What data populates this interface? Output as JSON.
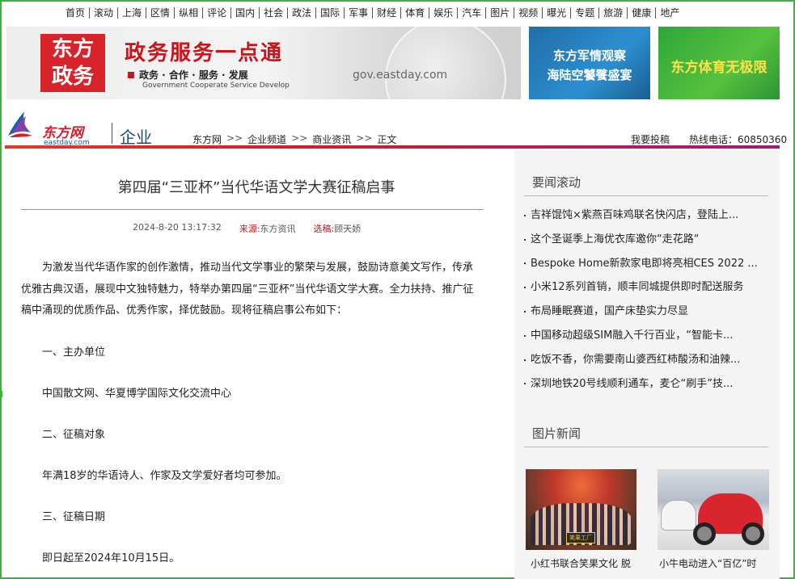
{
  "topnav": [
    "首页",
    "滚动",
    "上海",
    "区情",
    "纵相",
    "评论",
    "国内",
    "社会",
    "政法",
    "国际",
    "军事",
    "财经",
    "体育",
    "娱乐",
    "汽车",
    "图片",
    "视频",
    "曝光",
    "专题",
    "旅游",
    "健康",
    "地产"
  ],
  "banners": {
    "gov_logo": [
      "东方",
      "政务"
    ],
    "gov_slogan": "政务服务一点通",
    "gov_sub": "政务 · 合作 · 服务 · 发展",
    "gov_en": "Government Cooperate Service Develop",
    "gov_url": "gov.eastday.com",
    "military": [
      "东方军情观察",
      "海陆空饕餮盛宴"
    ],
    "sports": "东方体育无极限"
  },
  "site": {
    "name": "东方网",
    "domain": "eastday.com",
    "channel": "企业",
    "breadcrumbs": [
      "东方网",
      "企业频道",
      "商业资讯",
      "正文"
    ],
    "crumb_sep": ">>",
    "submit": "我要投稿",
    "hotline": "热线电话：60850360"
  },
  "article": {
    "title": "第四届“三亚杯”当代华语文学大赛征稿启事",
    "datetime": "2024-8-20 13:17:32",
    "source_label": "来源:",
    "source": "东方资讯",
    "editor_label": "选稿:",
    "editor": "顾天娇",
    "paragraphs": [
      "为激发当代华语作家的创作激情，推动当代文学事业的繁荣与发展，鼓励诗意美文写作，传承优雅古典汉语，展现中文独特魅力，特举办第四届“三亚杯”当代华语文学大赛。全力扶持、推广征稿中涌现的优质作品、优秀作家，择优鼓励。现将征稿启事公布如下：",
      "一、主办单位",
      "中国散文网、华夏博学国际文化交流中心",
      "二、征稿对象",
      "年满18岁的华语诗人、作家及文学爱好者均可参加。",
      "三、征稿日期",
      "即日起至2024年10月15日。"
    ]
  },
  "sidebar": {
    "news_heading": "要闻滚动",
    "news": [
      "吉祥馄饨×紫燕百味鸡联名快闪店，登陆上...",
      "这个圣诞季上海优衣库邀你“走花路“",
      "Bespoke Home新款家电即将亮相CES 2022 ...",
      "小米12系列首销，顺丰同城提供即时配送服务",
      "布局睡眠赛道，国产床垫实力尽显",
      "中国移动超级SIM融入千行百业，“智能卡...",
      "吃饭不香，你需要南山婆西红柿酸汤和油辣...",
      "深圳地铁20号线顺利通车，麦仑“刷手”技..."
    ],
    "photo_heading": "图片新闻",
    "photos": [
      {
        "caption": "小红书联合笑果文化 脱",
        "stage_text": "笑果工厂"
      },
      {
        "caption": "小牛电动进入“百亿”时"
      }
    ]
  }
}
